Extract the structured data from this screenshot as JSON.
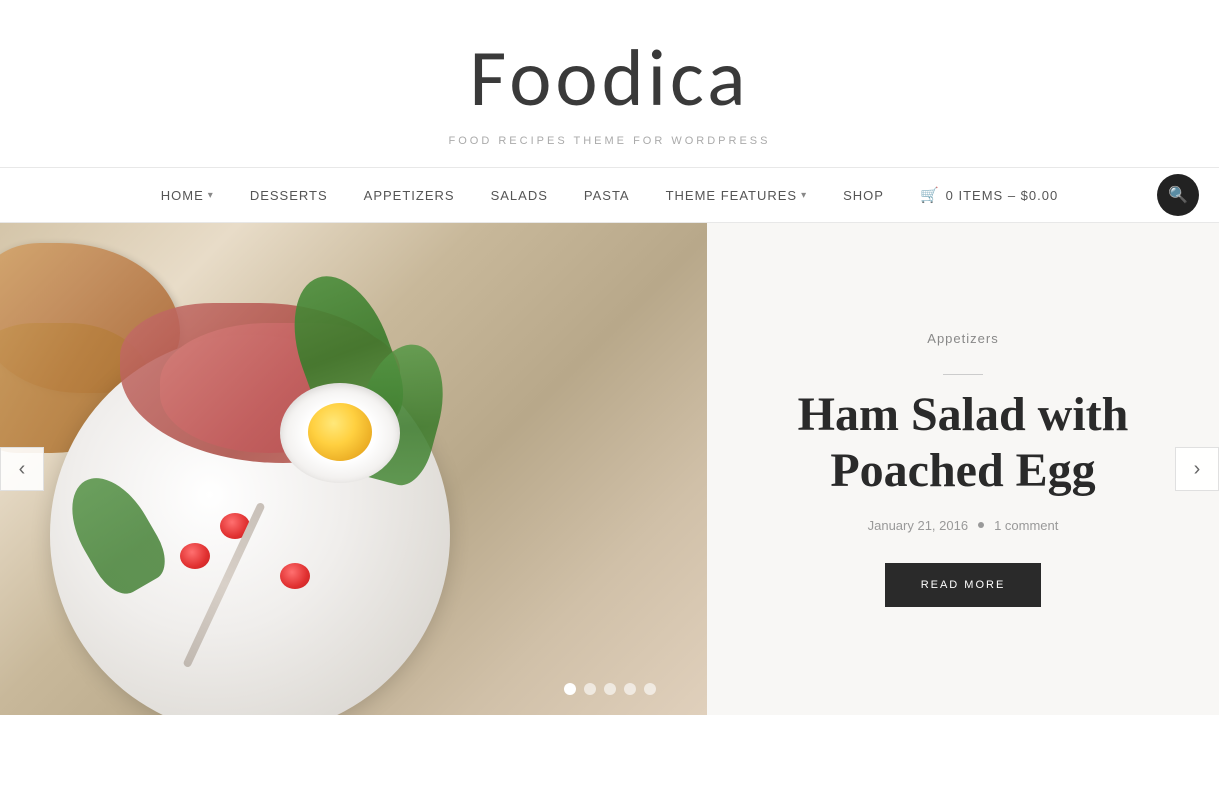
{
  "site": {
    "title": "Foodica",
    "tagline": "FOOD RECIPES THEME FOR WORDPRESS"
  },
  "nav": {
    "items": [
      {
        "label": "HOME",
        "hasDropdown": true
      },
      {
        "label": "DESSERTS",
        "hasDropdown": false
      },
      {
        "label": "APPETIZERS",
        "hasDropdown": false
      },
      {
        "label": "SALADS",
        "hasDropdown": false
      },
      {
        "label": "PASTA",
        "hasDropdown": false
      },
      {
        "label": "THEME FEATURES",
        "hasDropdown": true
      },
      {
        "label": "SHOP",
        "hasDropdown": false
      }
    ],
    "cart": {
      "label": "0 ITEMS – $0.00"
    },
    "search_icon": "🔍"
  },
  "hero": {
    "category": "Appetizers",
    "title": "Ham Salad with Poached Egg",
    "date": "January 21, 2016",
    "comments": "1 comment",
    "read_more": "READ MORE",
    "prev_label": "‹",
    "next_label": "›",
    "dots": [
      {
        "active": true
      },
      {
        "active": false
      },
      {
        "active": false
      },
      {
        "active": false
      },
      {
        "active": false
      }
    ]
  }
}
